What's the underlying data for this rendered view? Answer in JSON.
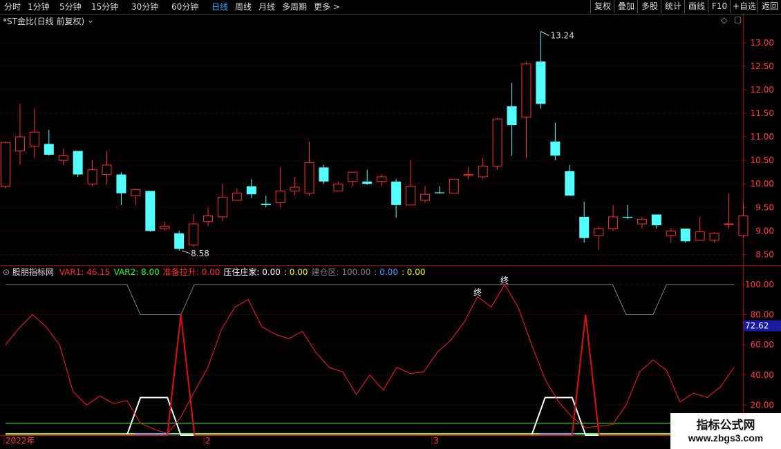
{
  "toolbar": {
    "left": [
      {
        "label": "分时",
        "active": false
      },
      {
        "label": "1分钟",
        "active": false
      },
      {
        "label": "5分钟",
        "active": false
      },
      {
        "label": "15分钟",
        "active": false
      },
      {
        "label": "30分钟",
        "active": false
      },
      {
        "label": "60分钟",
        "active": false
      },
      {
        "label": "日线",
        "active": true
      },
      {
        "label": "周线",
        "active": false
      },
      {
        "label": "月线",
        "active": false
      },
      {
        "label": "多周期",
        "active": false
      },
      {
        "label": "更多",
        "active": false
      }
    ],
    "right": [
      "复权",
      "叠加",
      "多股",
      "统计",
      "画线",
      "F10",
      "+自选",
      "返回"
    ]
  },
  "main_panel": {
    "title": "*ST金比(日线 前复权)",
    "high_label": "13.24",
    "low_label": "8.58"
  },
  "indicator_panel": {
    "name": "股朋指标网",
    "legend": [
      {
        "text": "VAR1: 46.15",
        "color": "#ff3030"
      },
      {
        "text": "VAR2: 8.00",
        "color": "#30ff30"
      },
      {
        "text": "准备拉升: 0.00",
        "color": "#ff3030"
      },
      {
        "text": "压住庄家: 0.00",
        "color": "#ffffff"
      },
      {
        "text": ": 0.00",
        "color": "#ffff00"
      },
      {
        "text": "建仓区: 100.00",
        "color": "#808080"
      },
      {
        "text": ": 0.00",
        "color": "#40a0ff"
      },
      {
        "text": ": 0.00",
        "color": "#ffff00"
      }
    ],
    "markers": [
      "终",
      "终"
    ],
    "current_value": "72.62"
  },
  "x_axis": {
    "labels": [
      "2022年",
      "2",
      "3"
    ]
  },
  "watermark": {
    "line1": "指标公式网",
    "line2": "www.zbgs3.com"
  },
  "colors": {
    "up": "#ff3030",
    "down": "#54ffff",
    "grid": "#7a0000",
    "axis": "#aa0000",
    "var1": "#ff2020",
    "var2": "#30ff30",
    "white_line": "#ffffff",
    "gray_line": "#808080",
    "cyan_line": "#40c0ff"
  },
  "chart_data": [
    {
      "type": "candlestick",
      "title": "*ST金比(日线 前复权)",
      "ylim": [
        8.3,
        13.35
      ],
      "yticks": [
        8.5,
        9.0,
        9.5,
        10.0,
        10.5,
        11.0,
        11.5,
        12.0,
        12.5,
        13.0
      ],
      "candles": [
        {
          "o": 9.95,
          "h": 10.9,
          "l": 9.9,
          "c": 10.88
        },
        {
          "o": 10.7,
          "h": 11.7,
          "l": 10.4,
          "c": 11.0
        },
        {
          "o": 10.8,
          "h": 11.6,
          "l": 10.55,
          "c": 11.1
        },
        {
          "o": 10.85,
          "h": 11.15,
          "l": 10.6,
          "c": 10.62
        },
        {
          "o": 10.5,
          "h": 10.75,
          "l": 10.4,
          "c": 10.6
        },
        {
          "o": 10.7,
          "h": 10.7,
          "l": 10.15,
          "c": 10.2
        },
        {
          "o": 10.0,
          "h": 10.5,
          "l": 9.95,
          "c": 10.3
        },
        {
          "o": 10.2,
          "h": 10.7,
          "l": 10.0,
          "c": 10.4
        },
        {
          "o": 10.2,
          "h": 10.25,
          "l": 9.55,
          "c": 9.8
        },
        {
          "o": 9.75,
          "h": 9.9,
          "l": 9.55,
          "c": 9.88
        },
        {
          "o": 9.85,
          "h": 9.85,
          "l": 8.98,
          "c": 9.0
        },
        {
          "o": 9.05,
          "h": 9.2,
          "l": 9.0,
          "c": 9.1
        },
        {
          "o": 8.95,
          "h": 9.0,
          "l": 8.58,
          "c": 8.62
        },
        {
          "o": 8.7,
          "h": 9.35,
          "l": 8.65,
          "c": 9.15
        },
        {
          "o": 9.2,
          "h": 9.5,
          "l": 9.1,
          "c": 9.32
        },
        {
          "o": 9.3,
          "h": 10.0,
          "l": 9.2,
          "c": 9.72
        },
        {
          "o": 9.65,
          "h": 9.9,
          "l": 9.65,
          "c": 9.8
        },
        {
          "o": 9.95,
          "h": 10.1,
          "l": 9.7,
          "c": 9.78
        },
        {
          "o": 9.58,
          "h": 9.75,
          "l": 9.5,
          "c": 9.55
        },
        {
          "o": 9.6,
          "h": 10.35,
          "l": 9.5,
          "c": 9.85
        },
        {
          "o": 9.85,
          "h": 10.15,
          "l": 9.75,
          "c": 9.93
        },
        {
          "o": 9.8,
          "h": 10.9,
          "l": 9.75,
          "c": 10.45
        },
        {
          "o": 10.35,
          "h": 10.4,
          "l": 10.0,
          "c": 10.05
        },
        {
          "o": 9.85,
          "h": 10.05,
          "l": 9.85,
          "c": 10.0
        },
        {
          "o": 10.05,
          "h": 10.25,
          "l": 9.95,
          "c": 10.25
        },
        {
          "o": 10.05,
          "h": 10.3,
          "l": 9.98,
          "c": 10.0
        },
        {
          "o": 10.05,
          "h": 10.2,
          "l": 9.95,
          "c": 10.15
        },
        {
          "o": 10.05,
          "h": 10.1,
          "l": 9.28,
          "c": 9.55
        },
        {
          "o": 9.55,
          "h": 10.5,
          "l": 9.55,
          "c": 9.95
        },
        {
          "o": 9.65,
          "h": 9.95,
          "l": 9.6,
          "c": 9.78
        },
        {
          "o": 9.82,
          "h": 9.95,
          "l": 9.8,
          "c": 9.8
        },
        {
          "o": 9.8,
          "h": 10.1,
          "l": 9.8,
          "c": 10.1
        },
        {
          "o": 10.18,
          "h": 10.35,
          "l": 10.1,
          "c": 10.2
        },
        {
          "o": 10.15,
          "h": 10.55,
          "l": 10.1,
          "c": 10.38
        },
        {
          "o": 10.38,
          "h": 11.4,
          "l": 10.3,
          "c": 11.38
        },
        {
          "o": 11.65,
          "h": 12.15,
          "l": 10.6,
          "c": 11.25
        },
        {
          "o": 11.42,
          "h": 12.6,
          "l": 10.55,
          "c": 12.55
        },
        {
          "o": 12.6,
          "h": 13.24,
          "l": 11.6,
          "c": 11.7
        },
        {
          "o": 10.9,
          "h": 11.3,
          "l": 10.5,
          "c": 10.6
        },
        {
          "o": 10.27,
          "h": 10.4,
          "l": 9.75,
          "c": 9.75
        },
        {
          "o": 9.3,
          "h": 9.62,
          "l": 8.75,
          "c": 8.85
        },
        {
          "o": 8.9,
          "h": 9.1,
          "l": 8.6,
          "c": 9.05
        },
        {
          "o": 9.05,
          "h": 9.55,
          "l": 9.0,
          "c": 9.3
        },
        {
          "o": 9.3,
          "h": 9.55,
          "l": 9.25,
          "c": 9.28
        },
        {
          "o": 9.15,
          "h": 9.3,
          "l": 9.05,
          "c": 9.25
        },
        {
          "o": 9.35,
          "h": 9.35,
          "l": 9.05,
          "c": 9.12
        },
        {
          "o": 8.9,
          "h": 9.05,
          "l": 8.75,
          "c": 9.0
        },
        {
          "o": 9.05,
          "h": 9.05,
          "l": 8.75,
          "c": 8.78
        },
        {
          "o": 8.8,
          "h": 9.3,
          "l": 8.8,
          "c": 8.98
        },
        {
          "o": 8.8,
          "h": 8.98,
          "l": 8.75,
          "c": 8.95
        },
        {
          "o": 9.15,
          "h": 9.8,
          "l": 9.05,
          "c": 9.15
        },
        {
          "o": 8.9,
          "h": 9.6,
          "l": 8.85,
          "c": 9.32
        }
      ]
    },
    {
      "type": "line",
      "ylim": [
        0,
        105
      ],
      "yticks": [
        20,
        40,
        60,
        80,
        100
      ],
      "series": [
        {
          "name": "VAR1",
          "values": [
            60,
            71,
            80,
            72,
            60,
            29,
            20,
            26,
            21,
            23,
            8,
            4,
            1,
            12,
            29,
            45,
            70,
            85,
            90,
            72,
            67,
            64,
            69,
            55,
            45,
            42,
            27,
            40,
            30,
            45,
            41,
            42,
            55,
            63,
            75,
            92,
            85,
            100,
            85,
            60,
            37,
            22,
            12,
            5,
            6,
            7,
            20,
            42,
            50,
            43,
            22,
            28,
            25,
            32,
            45
          ]
        },
        {
          "name": "VAR2",
          "values": [
            8,
            8,
            8,
            8,
            8,
            8,
            8,
            8,
            8,
            8,
            8,
            8,
            8,
            8,
            8,
            8,
            8,
            8,
            8,
            8,
            8,
            8,
            8,
            8,
            8,
            8,
            8,
            8,
            8,
            8,
            8,
            8,
            8,
            8,
            8,
            8,
            8,
            8,
            8,
            8,
            8,
            8,
            8,
            8,
            8,
            8,
            8,
            8,
            8,
            8,
            8,
            8,
            8,
            8,
            8
          ]
        },
        {
          "name": "准备拉升",
          "values": [
            0,
            0,
            0,
            0,
            0,
            0,
            0,
            0,
            0,
            0,
            0,
            0,
            0,
            80,
            0,
            0,
            0,
            0,
            0,
            0,
            0,
            0,
            0,
            0,
            0,
            0,
            0,
            0,
            0,
            0,
            0,
            0,
            0,
            0,
            0,
            0,
            0,
            0,
            0,
            0,
            0,
            0,
            0,
            80,
            0,
            0,
            0,
            0,
            0,
            0,
            0,
            0,
            0,
            0,
            0
          ]
        },
        {
          "name": "压住庄家",
          "values": [
            0,
            0,
            0,
            0,
            0,
            0,
            0,
            0,
            0,
            0,
            25,
            25,
            25,
            0,
            0,
            0,
            0,
            0,
            0,
            0,
            0,
            0,
            0,
            0,
            0,
            0,
            0,
            0,
            0,
            0,
            0,
            0,
            0,
            0,
            0,
            0,
            0,
            0,
            0,
            0,
            25,
            25,
            25,
            0,
            0,
            0,
            0,
            0,
            0,
            0,
            0,
            0,
            0,
            0,
            0
          ]
        },
        {
          "name": "建仓区",
          "values": [
            100,
            100,
            100,
            100,
            100,
            100,
            100,
            100,
            100,
            100,
            80,
            80,
            80,
            80,
            100,
            100,
            100,
            100,
            100,
            100,
            100,
            100,
            100,
            100,
            100,
            100,
            100,
            100,
            100,
            100,
            100,
            100,
            100,
            100,
            100,
            100,
            100,
            100,
            100,
            100,
            100,
            100,
            100,
            100,
            100,
            100,
            80,
            80,
            80,
            100,
            100,
            100,
            100,
            100,
            100
          ]
        }
      ]
    }
  ]
}
